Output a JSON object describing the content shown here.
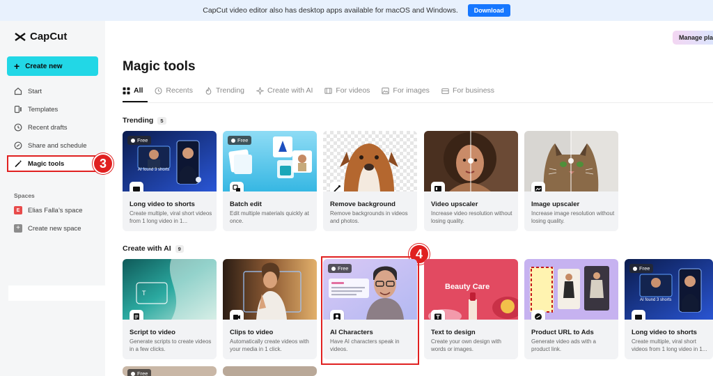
{
  "banner": {
    "text": "CapCut video editor also has desktop apps available for macOS and Windows.",
    "download_label": "Download"
  },
  "sidebar": {
    "logo": "CapCut",
    "create_new": "Create new",
    "items": [
      {
        "label": "Start",
        "icon": "home-icon"
      },
      {
        "label": "Templates",
        "icon": "templates-icon"
      },
      {
        "label": "Recent drafts",
        "icon": "clock-icon"
      },
      {
        "label": "Share and schedule",
        "icon": "share-icon"
      },
      {
        "label": "Magic tools",
        "icon": "magic-wand-icon",
        "active": true
      }
    ],
    "spaces_label": "Spaces",
    "space_badge": "E",
    "space_name": "Elias Falla’s space",
    "create_space": "Create new space"
  },
  "header": {
    "manage_plan": "Manage plan"
  },
  "main": {
    "title": "Magic tools",
    "tabs": [
      {
        "label": "All",
        "active": true
      },
      {
        "label": "Recents"
      },
      {
        "label": "Trending"
      },
      {
        "label": "Create with AI"
      },
      {
        "label": "For videos"
      },
      {
        "label": "For images"
      },
      {
        "label": "For business"
      }
    ],
    "trending": {
      "title": "Trending",
      "count": "5",
      "cards": [
        {
          "name": "Long video to shorts",
          "desc": "Create multiple, viral short videos from 1 long video in 1...",
          "free": "Free",
          "thumb_text": "AI found 3 shorts"
        },
        {
          "name": "Batch edit",
          "desc": "Edit multiple materials quickly at once.",
          "free": "Free"
        },
        {
          "name": "Remove background",
          "desc": "Remove backgrounds in videos and photos."
        },
        {
          "name": "Video upscaler",
          "desc": "Increase video resolution without losing quality."
        },
        {
          "name": "Image upscaler",
          "desc": "Increase image resolution without losing quality."
        }
      ]
    },
    "create_ai": {
      "title": "Create with AI",
      "count": "9",
      "cards": [
        {
          "name": "Script to video",
          "desc": "Generate scripts to create videos in a few clicks."
        },
        {
          "name": "Clips to video",
          "desc": "Automatically create videos with your media in 1 click."
        },
        {
          "name": "AI Characters",
          "desc": "Have AI characters speak in videos.",
          "free": "Free"
        },
        {
          "name": "Text to design",
          "desc": "Create your own design with words or images.",
          "thumb_text": "Beauty Care"
        },
        {
          "name": "Product URL to Ads",
          "desc": "Generate video ads with a product link."
        },
        {
          "name": "Long video to shorts",
          "desc": "Create multiple, viral short videos from 1 long video in 1...",
          "free": "Free",
          "thumb_text": "AI found 3 shorts"
        }
      ]
    },
    "partial_free": "Free"
  },
  "steps": {
    "three": "3",
    "four": "4"
  }
}
